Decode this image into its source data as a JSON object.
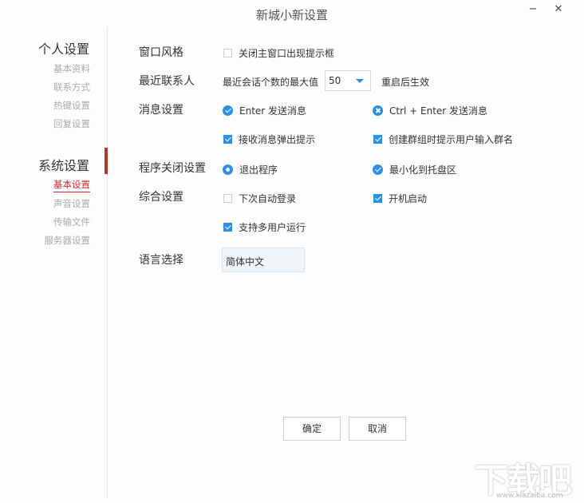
{
  "window": {
    "title": "新城小新设置",
    "minimize": "−",
    "close": "✕"
  },
  "sidebar": {
    "personal": {
      "title": "个人设置",
      "items": [
        "基本资料",
        "联系方式",
        "热键设置",
        "回复设置"
      ]
    },
    "system": {
      "title": "系统设置",
      "items": [
        "基本设置",
        "声音设置",
        "传输文件",
        "服务器设置"
      ],
      "active_index": 0
    }
  },
  "settings": {
    "window_style": {
      "label": "窗口风格",
      "option": "关闭主窗口出现提示框",
      "checked": false
    },
    "recent_contacts": {
      "label": "最近联系人",
      "prefix": "最近会话个数的最大值",
      "value": "50",
      "suffix": "重启后生效"
    },
    "message": {
      "label": "消息设置",
      "enter_send": "Enter 发送消息",
      "ctrl_enter_send": "Ctrl + Enter 发送消息",
      "popup_notify": "接收消息弹出提示",
      "group_name_prompt": "创建群组时提示用户输入群名"
    },
    "close_program": {
      "label": "程序关闭设置",
      "exit": "退出程序",
      "minimize_tray": "最小化到托盘区"
    },
    "general": {
      "label": "综合设置",
      "auto_login": "下次自动登录",
      "startup": "开机启动",
      "multi_user": "支持多用户运行"
    },
    "language": {
      "label": "语言选择",
      "value": "简体中文"
    }
  },
  "buttons": {
    "ok": "确定",
    "cancel": "取消"
  },
  "watermark": {
    "text": "下载吧",
    "url": "www.xiazaiba.com"
  },
  "colors": {
    "accent": "#2c8fe3",
    "active": "#c43030"
  }
}
